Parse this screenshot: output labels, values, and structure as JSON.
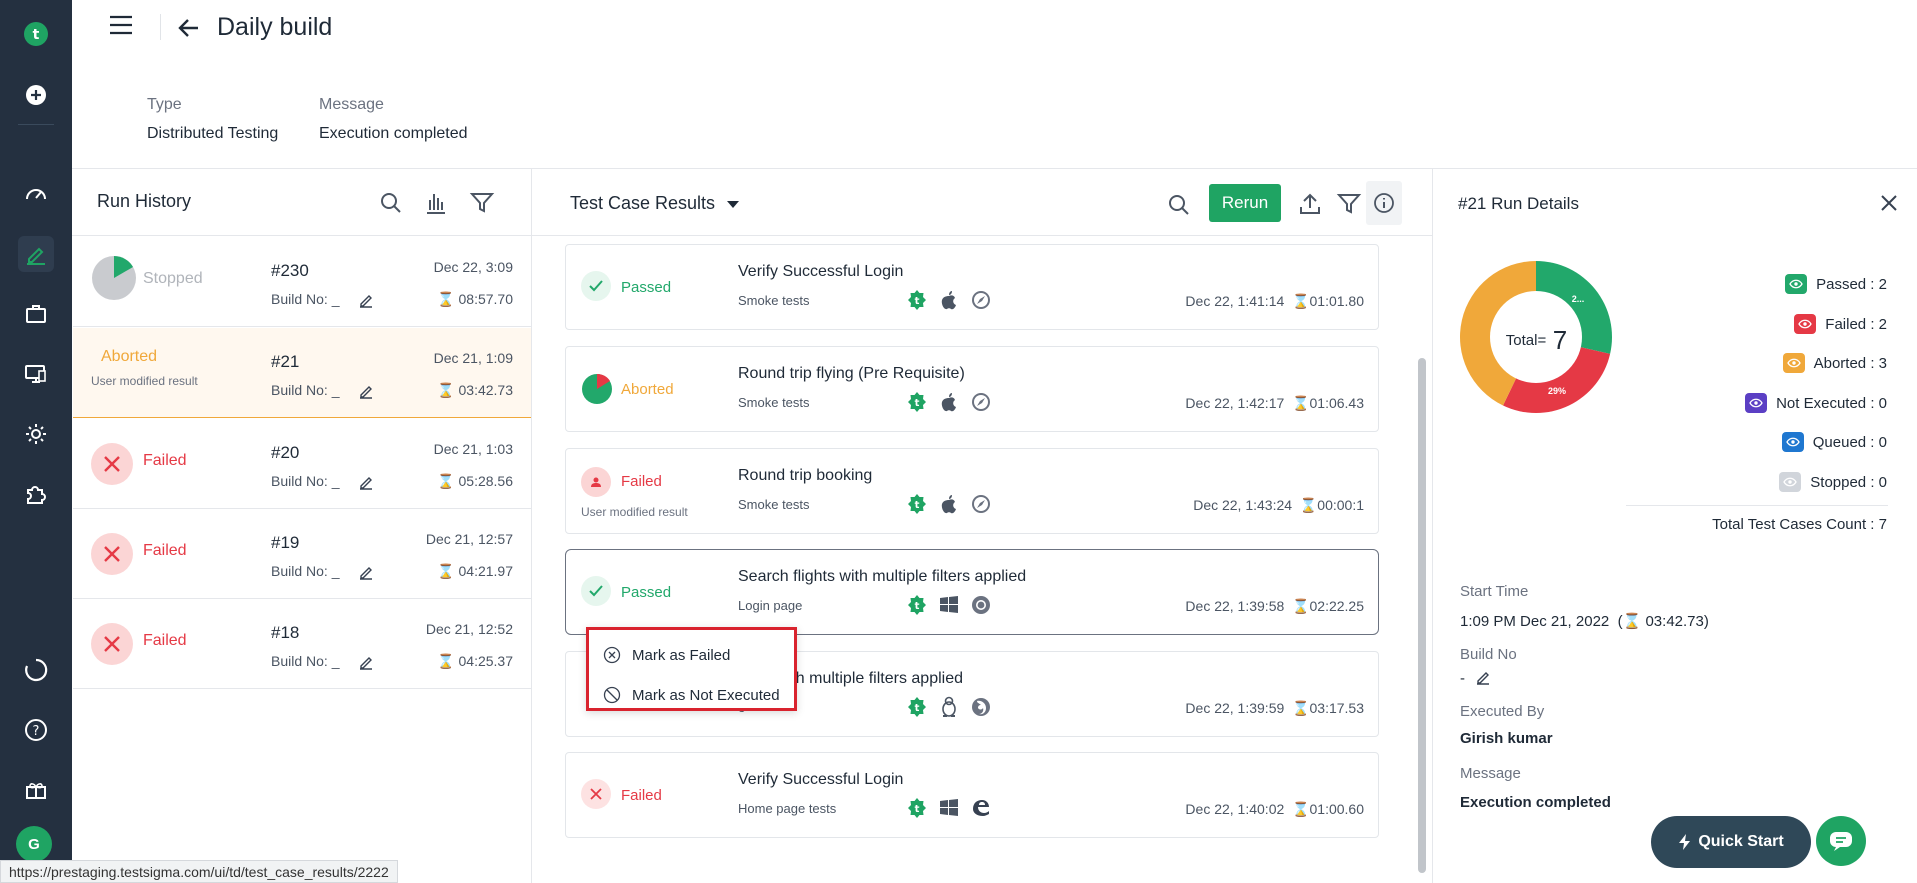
{
  "header": {
    "title": "Daily build",
    "type_label": "Type",
    "type_value": "Distributed Testing",
    "message_label": "Message",
    "message_value": "Execution completed"
  },
  "run_history": {
    "title": "Run History",
    "build_label": "Build No: _",
    "rows": [
      {
        "status": "Stopped",
        "number": "#230",
        "date": "Dec 22, 3:09",
        "duration": "08:57.70",
        "sub": ""
      },
      {
        "status": "Aborted",
        "number": "#21",
        "date": "Dec 21, 1:09",
        "duration": "03:42.73",
        "sub": "User modified result"
      },
      {
        "status": "Failed",
        "number": "#20",
        "date": "Dec 21, 1:03",
        "duration": "05:28.56",
        "sub": ""
      },
      {
        "status": "Failed",
        "number": "#19",
        "date": "Dec 21, 12:57",
        "duration": "04:21.97",
        "sub": ""
      },
      {
        "status": "Failed",
        "number": "#18",
        "date": "Dec 21, 12:52",
        "duration": "04:25.37",
        "sub": ""
      }
    ]
  },
  "results": {
    "title": "Test Case Results",
    "rerun_label": "Rerun",
    "cards": [
      {
        "status": "Passed",
        "sub": "",
        "name": "Verify Successful Login",
        "suite": "Smoke tests",
        "time": "Dec 22, 1:41:14",
        "duration": "01:01.80",
        "icons": [
          "testsigma-icon",
          "apple-icon",
          "safari-icon"
        ]
      },
      {
        "status": "Aborted",
        "sub": "",
        "name": "Round trip flying (Pre Requisite)",
        "suite": "Smoke tests",
        "time": "Dec 22, 1:42:17",
        "duration": "01:06.43",
        "icons": [
          "testsigma-icon",
          "apple-icon",
          "safari-icon"
        ]
      },
      {
        "status": "Failed",
        "sub": "User modified result",
        "name": "Round trip booking",
        "suite": "Smoke tests",
        "time": "Dec 22, 1:43:24",
        "duration": "00:00:1",
        "icons": [
          "testsigma-icon",
          "apple-icon",
          "safari-icon"
        ]
      },
      {
        "status": "Passed",
        "sub": "",
        "name": "Search flights with multiple filters applied",
        "suite": "Login page",
        "time": "Dec 22, 1:39:58",
        "duration": "02:22.25",
        "icons": [
          "testsigma-icon",
          "windows-icon",
          "chrome-icon"
        ]
      },
      {
        "status": "",
        "sub": "",
        "name": "ights with multiple filters applied",
        "suite": "e",
        "time": "Dec 22, 1:39:59",
        "duration": "03:17.53",
        "icons": [
          "testsigma-icon",
          "linux-icon",
          "firefox-icon"
        ]
      },
      {
        "status": "Failed",
        "sub": "",
        "name": "Verify Successful Login",
        "suite": "Home page tests",
        "time": "Dec 22, 1:40:02",
        "duration": "01:00.60",
        "icons": [
          "testsigma-icon",
          "windows-icon",
          "edge-icon"
        ]
      }
    ]
  },
  "context_menu": {
    "mark_failed": "Mark as Failed",
    "mark_not_executed": "Mark as Not Executed"
  },
  "run_details": {
    "title": "#21 Run Details",
    "total_label": "Total=",
    "total_value": "7",
    "donut_label_passed": "2...",
    "donut_label_failed": "29%",
    "legend": [
      {
        "label": "Passed : 2",
        "color": "#22a86b"
      },
      {
        "label": "Failed : 2",
        "color": "#e53945"
      },
      {
        "label": "Aborted : 3",
        "color": "#f0a83a"
      },
      {
        "label": "Not Executed : 0",
        "color": "#5b3fc4"
      },
      {
        "label": "Queued : 0",
        "color": "#1f77d0"
      },
      {
        "label": "Stopped : 0",
        "color": "#d1d5db"
      }
    ],
    "total_count": "Total Test Cases Count : 7",
    "start_time_label": "Start Time",
    "start_time_value": "1:09 PM Dec 21, 2022",
    "start_duration": "03:42.73)",
    "build_no_label": "Build No",
    "build_no_value": "-",
    "executed_by_label": "Executed By",
    "executed_by_value": "Girish kumar",
    "message_label": "Message",
    "message_value": "Execution completed"
  },
  "chart_data": {
    "type": "pie",
    "categories": [
      "Passed",
      "Failed",
      "Aborted",
      "Not Executed",
      "Queued",
      "Stopped"
    ],
    "values": [
      2,
      2,
      3,
      0,
      0,
      0
    ]
  },
  "quick_start_label": "Quick Start",
  "avatar_letter": "G",
  "status_url": "https://prestaging.testsigma.com/ui/td/test_case_results/2222",
  "colors": {
    "passed": "#22a86b",
    "failed": "#e53945",
    "aborted": "#f0a83a",
    "stopped": "#9ca3af",
    "nav_bg": "#243040"
  }
}
